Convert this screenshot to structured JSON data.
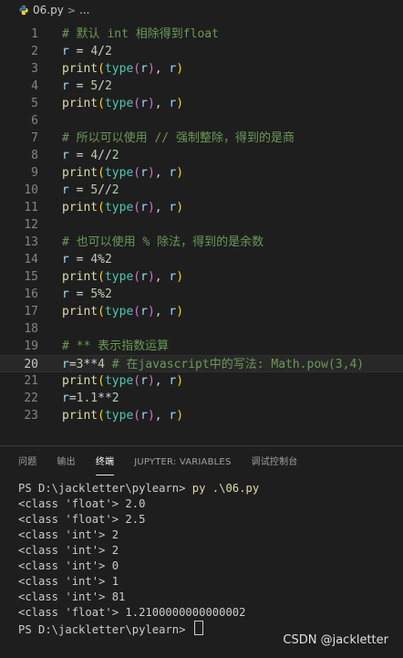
{
  "breadcrumb": {
    "file_name": "06.py",
    "separator": ">",
    "more": "..."
  },
  "editor": {
    "current_line": 20,
    "lines": [
      {
        "n": "1",
        "tokens": [
          {
            "t": "# 默认 int 相除得到float",
            "c": "cm"
          }
        ]
      },
      {
        "n": "2",
        "tokens": [
          {
            "t": "r",
            "c": "var"
          },
          {
            "t": " = ",
            "c": "op"
          },
          {
            "t": "4",
            "c": "num"
          },
          {
            "t": "/",
            "c": "op"
          },
          {
            "t": "2",
            "c": "num"
          }
        ]
      },
      {
        "n": "3",
        "tokens": [
          {
            "t": "print",
            "c": "fn"
          },
          {
            "t": "(",
            "c": "paren1"
          },
          {
            "t": "type",
            "c": "bi"
          },
          {
            "t": "(",
            "c": "paren2"
          },
          {
            "t": "r",
            "c": "var"
          },
          {
            "t": ")",
            "c": "paren2"
          },
          {
            "t": ", ",
            "c": "op"
          },
          {
            "t": "r",
            "c": "var"
          },
          {
            "t": ")",
            "c": "paren1"
          }
        ]
      },
      {
        "n": "4",
        "tokens": [
          {
            "t": "r",
            "c": "var"
          },
          {
            "t": " = ",
            "c": "op"
          },
          {
            "t": "5",
            "c": "num"
          },
          {
            "t": "/",
            "c": "op"
          },
          {
            "t": "2",
            "c": "num"
          }
        ]
      },
      {
        "n": "5",
        "tokens": [
          {
            "t": "print",
            "c": "fn"
          },
          {
            "t": "(",
            "c": "paren1"
          },
          {
            "t": "type",
            "c": "bi"
          },
          {
            "t": "(",
            "c": "paren2"
          },
          {
            "t": "r",
            "c": "var"
          },
          {
            "t": ")",
            "c": "paren2"
          },
          {
            "t": ", ",
            "c": "op"
          },
          {
            "t": "r",
            "c": "var"
          },
          {
            "t": ")",
            "c": "paren1"
          }
        ]
      },
      {
        "n": "6",
        "tokens": []
      },
      {
        "n": "7",
        "tokens": [
          {
            "t": "# 所以可以使用 // 强制整除，得到的是商",
            "c": "cm"
          }
        ]
      },
      {
        "n": "8",
        "tokens": [
          {
            "t": "r",
            "c": "var"
          },
          {
            "t": " = ",
            "c": "op"
          },
          {
            "t": "4",
            "c": "num"
          },
          {
            "t": "//",
            "c": "op"
          },
          {
            "t": "2",
            "c": "num"
          }
        ]
      },
      {
        "n": "9",
        "tokens": [
          {
            "t": "print",
            "c": "fn"
          },
          {
            "t": "(",
            "c": "paren1"
          },
          {
            "t": "type",
            "c": "bi"
          },
          {
            "t": "(",
            "c": "paren2"
          },
          {
            "t": "r",
            "c": "var"
          },
          {
            "t": ")",
            "c": "paren2"
          },
          {
            "t": ", ",
            "c": "op"
          },
          {
            "t": "r",
            "c": "var"
          },
          {
            "t": ")",
            "c": "paren1"
          }
        ]
      },
      {
        "n": "10",
        "tokens": [
          {
            "t": "r",
            "c": "var"
          },
          {
            "t": " = ",
            "c": "op"
          },
          {
            "t": "5",
            "c": "num"
          },
          {
            "t": "//",
            "c": "op"
          },
          {
            "t": "2",
            "c": "num"
          }
        ]
      },
      {
        "n": "11",
        "tokens": [
          {
            "t": "print",
            "c": "fn"
          },
          {
            "t": "(",
            "c": "paren1"
          },
          {
            "t": "type",
            "c": "bi"
          },
          {
            "t": "(",
            "c": "paren2"
          },
          {
            "t": "r",
            "c": "var"
          },
          {
            "t": ")",
            "c": "paren2"
          },
          {
            "t": ", ",
            "c": "op"
          },
          {
            "t": "r",
            "c": "var"
          },
          {
            "t": ")",
            "c": "paren1"
          }
        ]
      },
      {
        "n": "12",
        "tokens": []
      },
      {
        "n": "13",
        "tokens": [
          {
            "t": "# 也可以使用 % 除法，得到的是余数",
            "c": "cm"
          }
        ]
      },
      {
        "n": "14",
        "tokens": [
          {
            "t": "r",
            "c": "var"
          },
          {
            "t": " = ",
            "c": "op"
          },
          {
            "t": "4",
            "c": "num"
          },
          {
            "t": "%",
            "c": "op"
          },
          {
            "t": "2",
            "c": "num"
          }
        ]
      },
      {
        "n": "15",
        "tokens": [
          {
            "t": "print",
            "c": "fn"
          },
          {
            "t": "(",
            "c": "paren1"
          },
          {
            "t": "type",
            "c": "bi"
          },
          {
            "t": "(",
            "c": "paren2"
          },
          {
            "t": "r",
            "c": "var"
          },
          {
            "t": ")",
            "c": "paren2"
          },
          {
            "t": ", ",
            "c": "op"
          },
          {
            "t": "r",
            "c": "var"
          },
          {
            "t": ")",
            "c": "paren1"
          }
        ]
      },
      {
        "n": "16",
        "tokens": [
          {
            "t": "r",
            "c": "var"
          },
          {
            "t": " = ",
            "c": "op"
          },
          {
            "t": "5",
            "c": "num"
          },
          {
            "t": "%",
            "c": "op"
          },
          {
            "t": "2",
            "c": "num"
          }
        ]
      },
      {
        "n": "17",
        "tokens": [
          {
            "t": "print",
            "c": "fn"
          },
          {
            "t": "(",
            "c": "paren1"
          },
          {
            "t": "type",
            "c": "bi"
          },
          {
            "t": "(",
            "c": "paren2"
          },
          {
            "t": "r",
            "c": "var"
          },
          {
            "t": ")",
            "c": "paren2"
          },
          {
            "t": ", ",
            "c": "op"
          },
          {
            "t": "r",
            "c": "var"
          },
          {
            "t": ")",
            "c": "paren1"
          }
        ]
      },
      {
        "n": "18",
        "tokens": []
      },
      {
        "n": "19",
        "tokens": [
          {
            "t": "# ** 表示指数运算",
            "c": "cm"
          }
        ]
      },
      {
        "n": "20",
        "tokens": [
          {
            "t": "r",
            "c": "var"
          },
          {
            "t": "=",
            "c": "op"
          },
          {
            "t": "3",
            "c": "num"
          },
          {
            "t": "**",
            "c": "op"
          },
          {
            "t": "4",
            "c": "num"
          },
          {
            "t": " # 在javascript中的写法: Math.pow(3,4)",
            "c": "cm"
          }
        ]
      },
      {
        "n": "21",
        "tokens": [
          {
            "t": "print",
            "c": "fn"
          },
          {
            "t": "(",
            "c": "paren1"
          },
          {
            "t": "type",
            "c": "bi"
          },
          {
            "t": "(",
            "c": "paren2"
          },
          {
            "t": "r",
            "c": "var"
          },
          {
            "t": ")",
            "c": "paren2"
          },
          {
            "t": ", ",
            "c": "op"
          },
          {
            "t": "r",
            "c": "var"
          },
          {
            "t": ")",
            "c": "paren1"
          }
        ]
      },
      {
        "n": "22",
        "tokens": [
          {
            "t": "r",
            "c": "var"
          },
          {
            "t": "=",
            "c": "op"
          },
          {
            "t": "1.1",
            "c": "num"
          },
          {
            "t": "**",
            "c": "op"
          },
          {
            "t": "2",
            "c": "num"
          }
        ]
      },
      {
        "n": "23",
        "tokens": [
          {
            "t": "print",
            "c": "fn"
          },
          {
            "t": "(",
            "c": "paren1"
          },
          {
            "t": "type",
            "c": "bi"
          },
          {
            "t": "(",
            "c": "paren2"
          },
          {
            "t": "r",
            "c": "var"
          },
          {
            "t": ")",
            "c": "paren2"
          },
          {
            "t": ", ",
            "c": "op"
          },
          {
            "t": "r",
            "c": "var"
          },
          {
            "t": ")",
            "c": "paren1"
          }
        ]
      }
    ]
  },
  "panel": {
    "tabs": [
      {
        "label": "问题",
        "active": false
      },
      {
        "label": "输出",
        "active": false
      },
      {
        "label": "终端",
        "active": true
      },
      {
        "label": "JUPYTER: VARIABLES",
        "active": false
      },
      {
        "label": "调试控制台",
        "active": false
      }
    ]
  },
  "terminal": {
    "prompt1": "PS D:\\jackletter\\pylearn> ",
    "command": "py .\\06.py",
    "output": [
      "<class 'float'> 2.0",
      "<class 'float'> 2.5",
      "<class 'int'> 2",
      "<class 'int'> 2",
      "<class 'int'> 0",
      "<class 'int'> 1",
      "<class 'int'> 81",
      "<class 'float'> 1.2100000000000002"
    ],
    "prompt2": "PS D:\\jackletter\\pylearn> "
  },
  "watermark": "CSDN @jackletter",
  "colors": {
    "background": "#1e1e1e",
    "comment": "#6a9955",
    "variable": "#9cdcfe",
    "number": "#b5cea8",
    "function": "#dcdcaa",
    "builtin": "#4ec9b0",
    "paren_outer": "#ffd700",
    "paren_inner": "#da70d6"
  }
}
